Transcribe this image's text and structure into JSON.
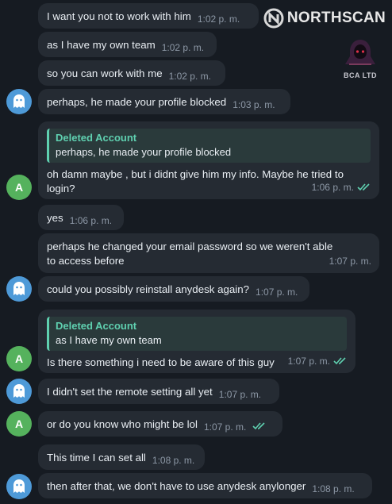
{
  "watermark": {
    "logo_text": "NORTHSCAN",
    "badge_text": "BCA LTD"
  },
  "colors": {
    "background": "#161b22",
    "bubble": "#252b33",
    "ghost_avatar": "#4e9ad8",
    "letter_avatar": "#55b25d",
    "reply_accent": "#5fd0b0",
    "read_checks": "#5fd0b0"
  },
  "messages": [
    {
      "text": "I want you not to work with him",
      "time": "1:02 p. m."
    },
    {
      "text": "as I have my own team",
      "time": "1:02 p. m."
    },
    {
      "text": "so you can work with me",
      "time": "1:02 p. m."
    },
    {
      "text": "perhaps, he made your profile blocked",
      "time": "1:03 p. m.",
      "avatar_icon": "ghost-icon"
    },
    {
      "reply_name": "Deleted Account",
      "reply_text": "perhaps, he made your profile blocked",
      "text": "oh damn maybe , but i didnt give him my info. Maybe he tried to login?",
      "time": "1:06 p. m.",
      "avatar_letter": "A",
      "status": "read"
    },
    {
      "text": "yes",
      "time": "1:06 p. m."
    },
    {
      "text": "perhaps he changed your email password so we weren't able to access before",
      "time": "1:07 p. m."
    },
    {
      "text": "could you possibly reinstall anydesk again?",
      "time": "1:07 p. m.",
      "avatar_icon": "ghost-icon"
    },
    {
      "reply_name": "Deleted Account",
      "reply_text": "as I have my own team",
      "text": "Is there something i need to be aware of this guy",
      "time": "1:07 p. m.",
      "avatar_letter": "A",
      "status": "read"
    },
    {
      "text": "I didn't set the remote setting all yet",
      "time": "1:07 p. m.",
      "avatar_icon": "ghost-icon"
    },
    {
      "text": "or do you know who might be lol",
      "time": "1:07 p. m.",
      "avatar_letter": "A",
      "status": "read"
    },
    {
      "text": "This time I can set all",
      "time": "1:08 p. m."
    },
    {
      "text": "then after that, we don't have to use anydesk anylonger",
      "time": "1:08 p. m.",
      "avatar_icon": "ghost-icon"
    }
  ]
}
